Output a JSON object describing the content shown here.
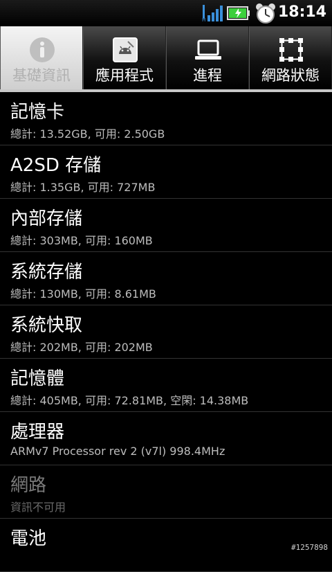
{
  "status_bar": {
    "time": "18:14",
    "icons": [
      "signal-icon",
      "battery-charging-icon",
      "alarm-clock-icon"
    ]
  },
  "tabs": [
    {
      "label": "基礎資訊",
      "icon": "info-icon",
      "selected": true
    },
    {
      "label": "應用程式",
      "icon": "android-apps-icon",
      "selected": false
    },
    {
      "label": "進程",
      "icon": "laptop-icon",
      "selected": false
    },
    {
      "label": "網路狀態",
      "icon": "network-grid-icon",
      "selected": false
    }
  ],
  "items": [
    {
      "title": "記憶卡",
      "detail": "總計: 13.52GB, 可用: 2.50GB",
      "enabled": true
    },
    {
      "title": "A2SD 存儲",
      "detail": "總計: 1.35GB, 可用: 727MB",
      "enabled": true
    },
    {
      "title": "內部存儲",
      "detail": "總計: 303MB, 可用: 160MB",
      "enabled": true
    },
    {
      "title": "系統存儲",
      "detail": "總計: 130MB, 可用: 8.61MB",
      "enabled": true
    },
    {
      "title": "系統快取",
      "detail": "總計: 202MB, 可用: 202MB",
      "enabled": true
    },
    {
      "title": "記憶體",
      "detail": "總計: 405MB, 可用: 72.81MB, 空閑: 14.38MB",
      "enabled": true
    },
    {
      "title": "處理器",
      "detail": "ARMv7 Processor rev 2 (v7l)  998.4MHz",
      "enabled": true
    },
    {
      "title": "網路",
      "detail": "資訊不可用",
      "enabled": false
    },
    {
      "title": "電池",
      "detail": "",
      "enabled": true
    }
  ],
  "watermark": "#1257898",
  "colors": {
    "tab_underline": "#c8c8c8",
    "battery_green": "#3ccf3c",
    "signal_blue": "#3a8fd9"
  }
}
